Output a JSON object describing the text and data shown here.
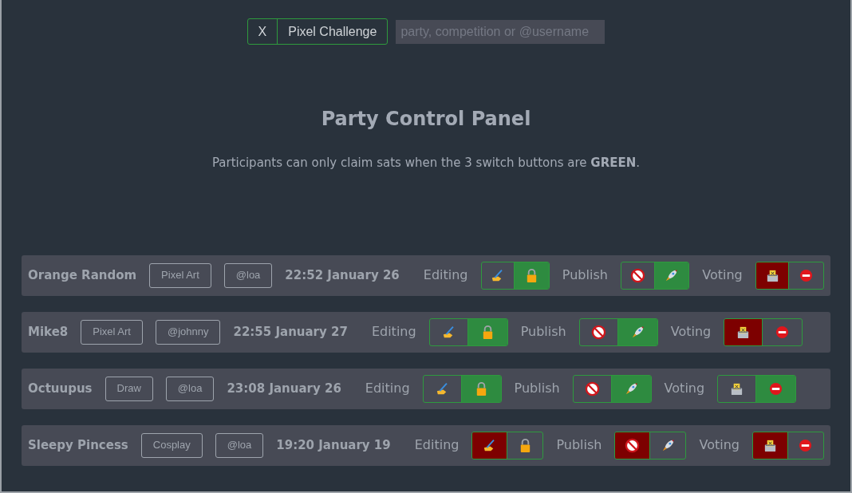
{
  "filter": {
    "clear_label": "X",
    "tag": "Pixel Challenge"
  },
  "search": {
    "placeholder": "party, competition or @username"
  },
  "title": "Party Control Panel",
  "notice": "Participants can only claim sats when the 3 switch buttons are **GREEN**.",
  "parties": [
    {
      "name": "Orange Random",
      "category": "Pixel Art",
      "user": "@loa",
      "time": "22:52 January 26",
      "switches": [
        {
          "label": "Editing",
          "kind": "editing",
          "on": true
        },
        {
          "label": "Publish",
          "kind": "publish",
          "on": true
        },
        {
          "label": "Voting",
          "kind": "voting",
          "on": false
        }
      ]
    },
    {
      "name": "Mike8",
      "category": "Pixel Art",
      "user": "@johnny",
      "time": "22:55 January 27",
      "switches": [
        {
          "label": "Editing",
          "kind": "editing",
          "on": true
        },
        {
          "label": "Publish",
          "kind": "publish",
          "on": true
        },
        {
          "label": "Voting",
          "kind": "voting",
          "on": false
        }
      ]
    },
    {
      "name": "Octuupus",
      "category": "Draw",
      "user": "@loa",
      "time": "23:08 January 26",
      "switches": [
        {
          "label": "Editing",
          "kind": "editing",
          "on": true
        },
        {
          "label": "Publish",
          "kind": "publish",
          "on": true
        },
        {
          "label": "Voting",
          "kind": "voting",
          "on": true
        }
      ]
    },
    {
      "name": "Sleepy Pincess",
      "category": "Cosplay",
      "user": "@loa",
      "time": "19:20 January 19",
      "switches": [
        {
          "label": "Editing",
          "kind": "editing",
          "on": false
        },
        {
          "label": "Publish",
          "kind": "publish",
          "on": false
        },
        {
          "label": "Voting",
          "kind": "voting",
          "on": false
        }
      ]
    }
  ]
}
